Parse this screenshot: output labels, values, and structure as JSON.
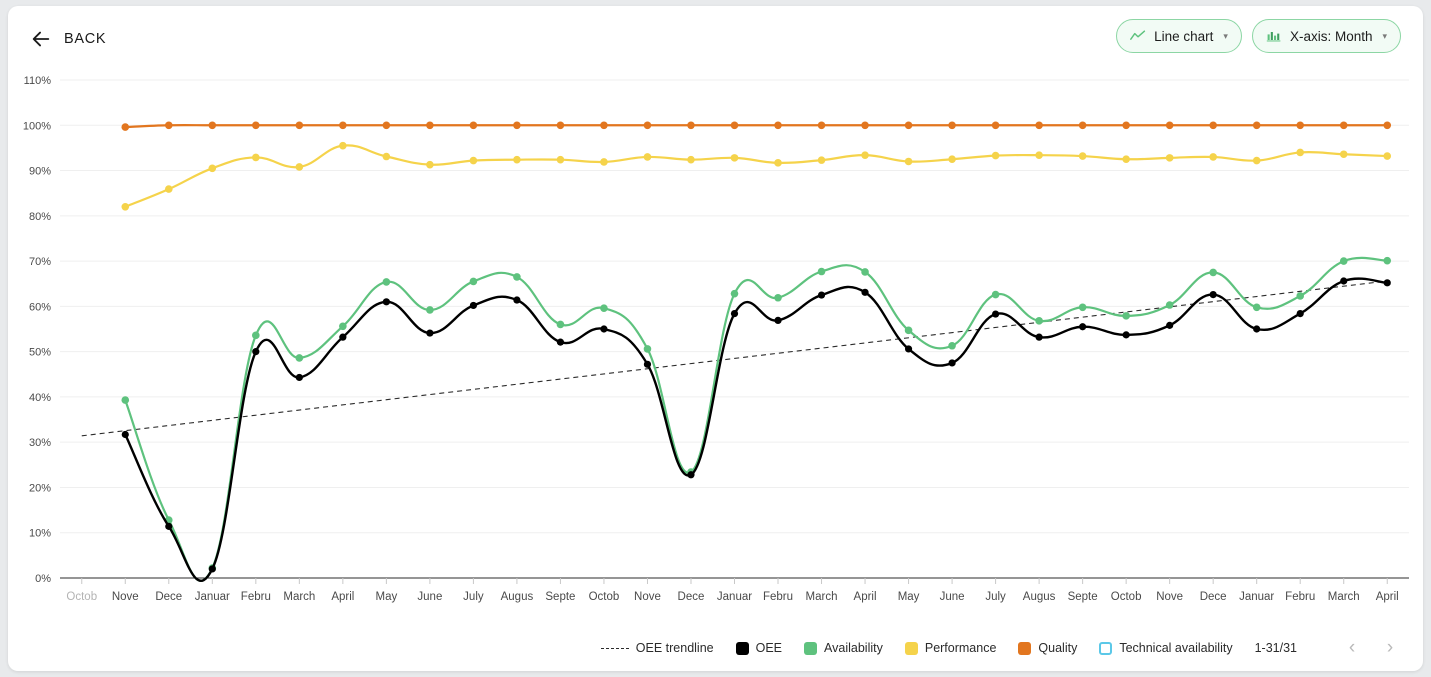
{
  "header": {
    "back_label": "BACK",
    "back_icon": "arrow-left-icon",
    "chart_type_button": {
      "label": "Line chart",
      "icon": "line-chart-icon",
      "caret": "▾"
    },
    "xaxis_button": {
      "label": "X-axis: Month",
      "icon": "bar-chart-icon",
      "caret": "▾"
    }
  },
  "legend": {
    "items": [
      {
        "label": "OEE trendline",
        "color": "#2b2b2b",
        "marker": "dashed-line",
        "active": true
      },
      {
        "label": "OEE",
        "color": "#000000",
        "marker": "square",
        "active": true
      },
      {
        "label": "Availability",
        "color": "#5ec27e",
        "marker": "square",
        "active": true
      },
      {
        "label": "Performance",
        "color": "#f5d34b",
        "marker": "square",
        "active": true
      },
      {
        "label": "Quality",
        "color": "#e2761f",
        "marker": "square",
        "active": true
      },
      {
        "label": "Technical availability",
        "color": "#5bc8e8",
        "marker": "hollow-square",
        "active": false
      }
    ],
    "pagination": {
      "range_label": "1-31/31",
      "prev_icon": "‹",
      "next_icon": "›"
    }
  },
  "chart_data": {
    "type": "line",
    "title": "",
    "xlabel": "",
    "ylabel": "",
    "ylim": [
      0,
      110
    ],
    "ytick_labels": [
      "0%",
      "10%",
      "20%",
      "30%",
      "40%",
      "50%",
      "60%",
      "70%",
      "80%",
      "90%",
      "100%",
      "110%"
    ],
    "ytick_values": [
      0,
      10,
      20,
      30,
      40,
      50,
      60,
      70,
      80,
      90,
      100,
      110
    ],
    "grid": true,
    "legend_position": "bottom-right",
    "smoothing": "spline",
    "categories": [
      "Octob",
      "Nove",
      "Dece",
      "Januar",
      "Febru",
      "March",
      "April",
      "May",
      "June",
      "July",
      "Augus",
      "Septe",
      "Octob",
      "Nove",
      "Dece",
      "Januar",
      "Febru",
      "March",
      "April",
      "May",
      "June",
      "July",
      "Augus",
      "Septe",
      "Octob",
      "Nove",
      "Dece",
      "Januar",
      "Febru",
      "March",
      "April"
    ],
    "categories_muted": [
      true,
      false,
      false,
      false,
      false,
      false,
      false,
      false,
      false,
      false,
      false,
      false,
      false,
      false,
      false,
      false,
      false,
      false,
      false,
      false,
      false,
      false,
      false,
      false,
      false,
      false,
      false,
      false,
      false,
      false,
      false
    ],
    "series": [
      {
        "name": "OEE",
        "color": "#000000",
        "values": [
          null,
          31.7,
          11.4,
          2.0,
          50.0,
          44.3,
          53.2,
          61.0,
          54.1,
          60.2,
          61.4,
          52.1,
          55.0,
          47.2,
          22.8,
          58.4,
          56.9,
          62.5,
          63.1,
          50.6,
          47.5,
          58.3,
          53.2,
          55.5,
          53.7,
          55.8,
          62.6,
          55.0,
          58.4,
          65.6,
          65.2
        ]
      },
      {
        "name": "Availability",
        "color": "#5ec27e",
        "values": [
          null,
          39.3,
          12.8,
          2.2,
          53.6,
          48.6,
          55.6,
          65.4,
          59.2,
          65.5,
          66.5,
          56.0,
          59.6,
          50.6,
          23.4,
          62.8,
          61.9,
          67.7,
          67.6,
          54.7,
          51.3,
          62.6,
          56.8,
          59.8,
          57.9,
          60.3,
          67.5,
          59.8,
          62.3,
          70.0,
          70.1
        ]
      },
      {
        "name": "Performance",
        "color": "#f5d34b",
        "values": [
          null,
          82.0,
          85.9,
          90.5,
          92.9,
          90.8,
          95.5,
          93.1,
          91.3,
          92.2,
          92.4,
          92.4,
          91.9,
          93.0,
          92.4,
          92.8,
          91.7,
          92.3,
          93.4,
          92.0,
          92.5,
          93.3,
          93.4,
          93.2,
          92.5,
          92.8,
          93.0,
          92.2,
          94.0,
          93.6,
          93.2
        ]
      },
      {
        "name": "Quality",
        "color": "#e2761f",
        "values": [
          null,
          99.6,
          100.0,
          100.0,
          100.0,
          100.0,
          100.0,
          100.0,
          100.0,
          100.0,
          100.0,
          100.0,
          100.0,
          100.0,
          100.0,
          100.0,
          100.0,
          100.0,
          100.0,
          100.0,
          100.0,
          100.0,
          100.0,
          100.0,
          100.0,
          100.0,
          100.0,
          100.0,
          100.0,
          100.0,
          100.0
        ]
      },
      {
        "name": "Technical availability",
        "color": "#5bc8e8",
        "values": [],
        "hidden": true
      }
    ],
    "trendline": {
      "name": "OEE trendline",
      "color": "#2b2b2b",
      "style": "dashed",
      "start_value": 31.4,
      "end_value": 65.6,
      "start_index": 0,
      "end_index": 30
    }
  }
}
